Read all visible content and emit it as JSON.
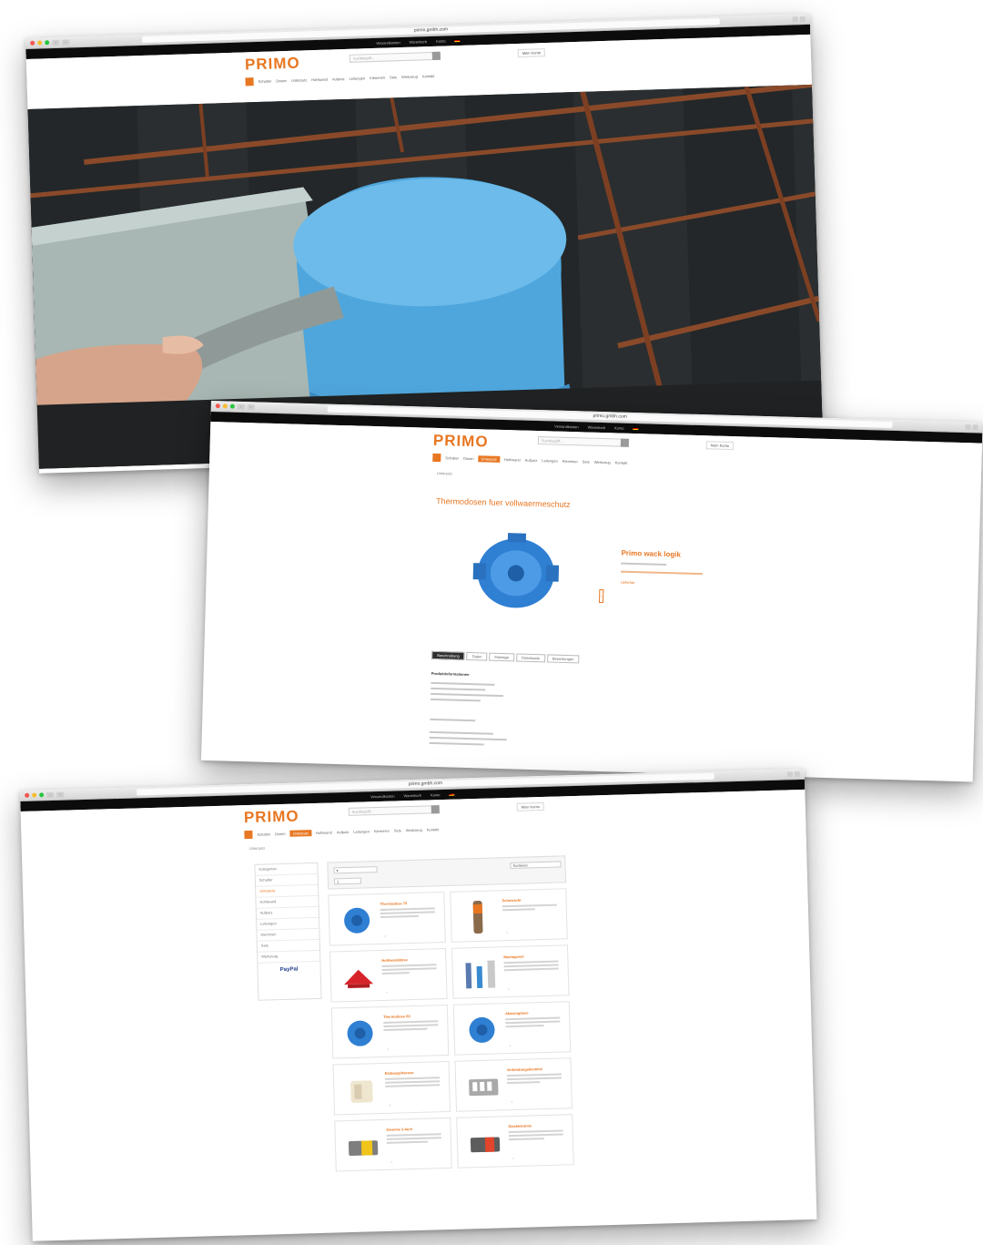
{
  "brand": {
    "logo": "PRIMO",
    "accent": "#e87722"
  },
  "browser": {
    "url": "primo.gmbh.com"
  },
  "topbar": {
    "items": [
      "Versandkosten",
      "Warenkorb",
      "Konto"
    ]
  },
  "header": {
    "search_placeholder": "Suchbegriff...",
    "account": "Mein Konto"
  },
  "nav": {
    "items": [
      "Schalter",
      "Dosen",
      "Unterputz",
      "Hohlwand",
      "Aufputz",
      "Leitungen",
      "Klemmen",
      "Sets",
      "Werkzeug",
      "Kontakt"
    ]
  },
  "product_page": {
    "breadcrumb": "Unterputz",
    "title": "Thermodosen fuer vollwaermeschutz",
    "product_name": "Primo wack logik",
    "tabs": [
      "Beschreibung",
      "Daten",
      "Montage",
      "Downloads",
      "Bewertungen"
    ],
    "desc_title": "Produktinformationen",
    "badge": "Lieferbar"
  },
  "listing_page": {
    "sort_label": "Sortieren",
    "sidebar": [
      "Kategorien",
      "Schalter",
      "Unterputz",
      "Hohlwand",
      "Aufputz",
      "Leitungen",
      "Klemmen",
      "Sets",
      "Werkzeug"
    ],
    "paypal": "PayPal",
    "products": [
      {
        "name": "Thermodose 70"
      },
      {
        "name": "Schutzrohr"
      },
      {
        "name": "Hohlwanddose"
      },
      {
        "name": "Montageset"
      },
      {
        "name": "Thermodose 60"
      },
      {
        "name": "Abzweigdose"
      },
      {
        "name": "Einbaugehaeuse"
      },
      {
        "name": "Verbindungsklemme"
      },
      {
        "name": "Klemme 5-fach"
      },
      {
        "name": "Steckklemme"
      }
    ]
  }
}
